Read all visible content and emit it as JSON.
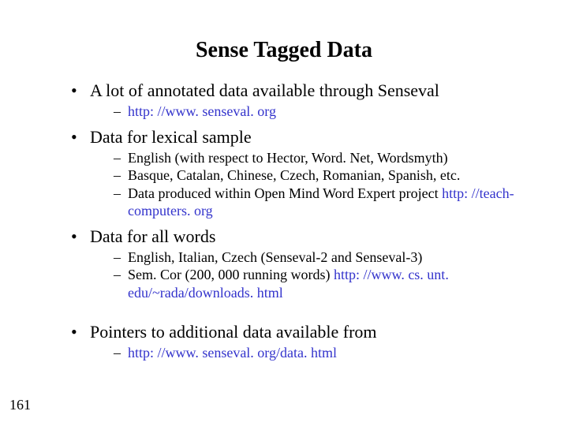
{
  "title": "Sense Tagged Data",
  "page_number": "161",
  "bullets": [
    {
      "text": "A lot of annotated data available through Senseval",
      "sub": [
        {
          "pre": "",
          "link": "http: //www. senseval. org",
          "post": ""
        }
      ]
    },
    {
      "text": "Data for lexical sample",
      "sub": [
        {
          "pre": "English (with respect to Hector, Word. Net, Wordsmyth)",
          "link": "",
          "post": ""
        },
        {
          "pre": "Basque, Catalan, Chinese, Czech, Romanian, Spanish, etc.",
          "link": "",
          "post": ""
        },
        {
          "pre": "Data produced within Open Mind Word Expert project ",
          "link": "http: //teach-computers. org",
          "post": ""
        }
      ]
    },
    {
      "text": "Data for all words",
      "sub": [
        {
          "pre": "English, Italian, Czech (Senseval-2 and Senseval-3)",
          "link": "",
          "post": ""
        },
        {
          "pre": "Sem. Cor (200, 000 running words) ",
          "link": "http: //www. cs. unt. edu/~rada/downloads. html",
          "post": ""
        }
      ]
    },
    {
      "text": "Pointers to additional data available from",
      "sub": [
        {
          "pre": "",
          "link": "http: //www. senseval. org/data. html",
          "post": ""
        }
      ]
    }
  ]
}
